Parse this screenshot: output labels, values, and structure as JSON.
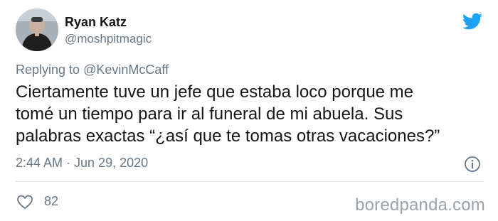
{
  "tweet": {
    "author_name": "Ryan Katz",
    "author_handle": "@moshpitmagic",
    "replying_prefix": "Replying to ",
    "replying_to": "@KevinMcCaff",
    "text_lines": [
      "Ciertamente tuve un jefe que estaba loco porque me",
      "tomé un tiempo para ir al funeral de mi abuela. Sus",
      "palabras exactas “¿así que te tomas otras vacaciones?”"
    ],
    "timestamp": "2:44 AM · Jun 29, 2020",
    "likes": "82"
  },
  "icons": {
    "brand": "twitter-bird-icon",
    "info": "info-icon",
    "like": "heart-icon",
    "avatar": "avatar"
  },
  "colors": {
    "twitter_blue": "#1da1f2",
    "secondary_text": "#657786",
    "primary_text": "#14171a",
    "divider": "#e1e8ed"
  },
  "watermark": "boredpanda.com"
}
